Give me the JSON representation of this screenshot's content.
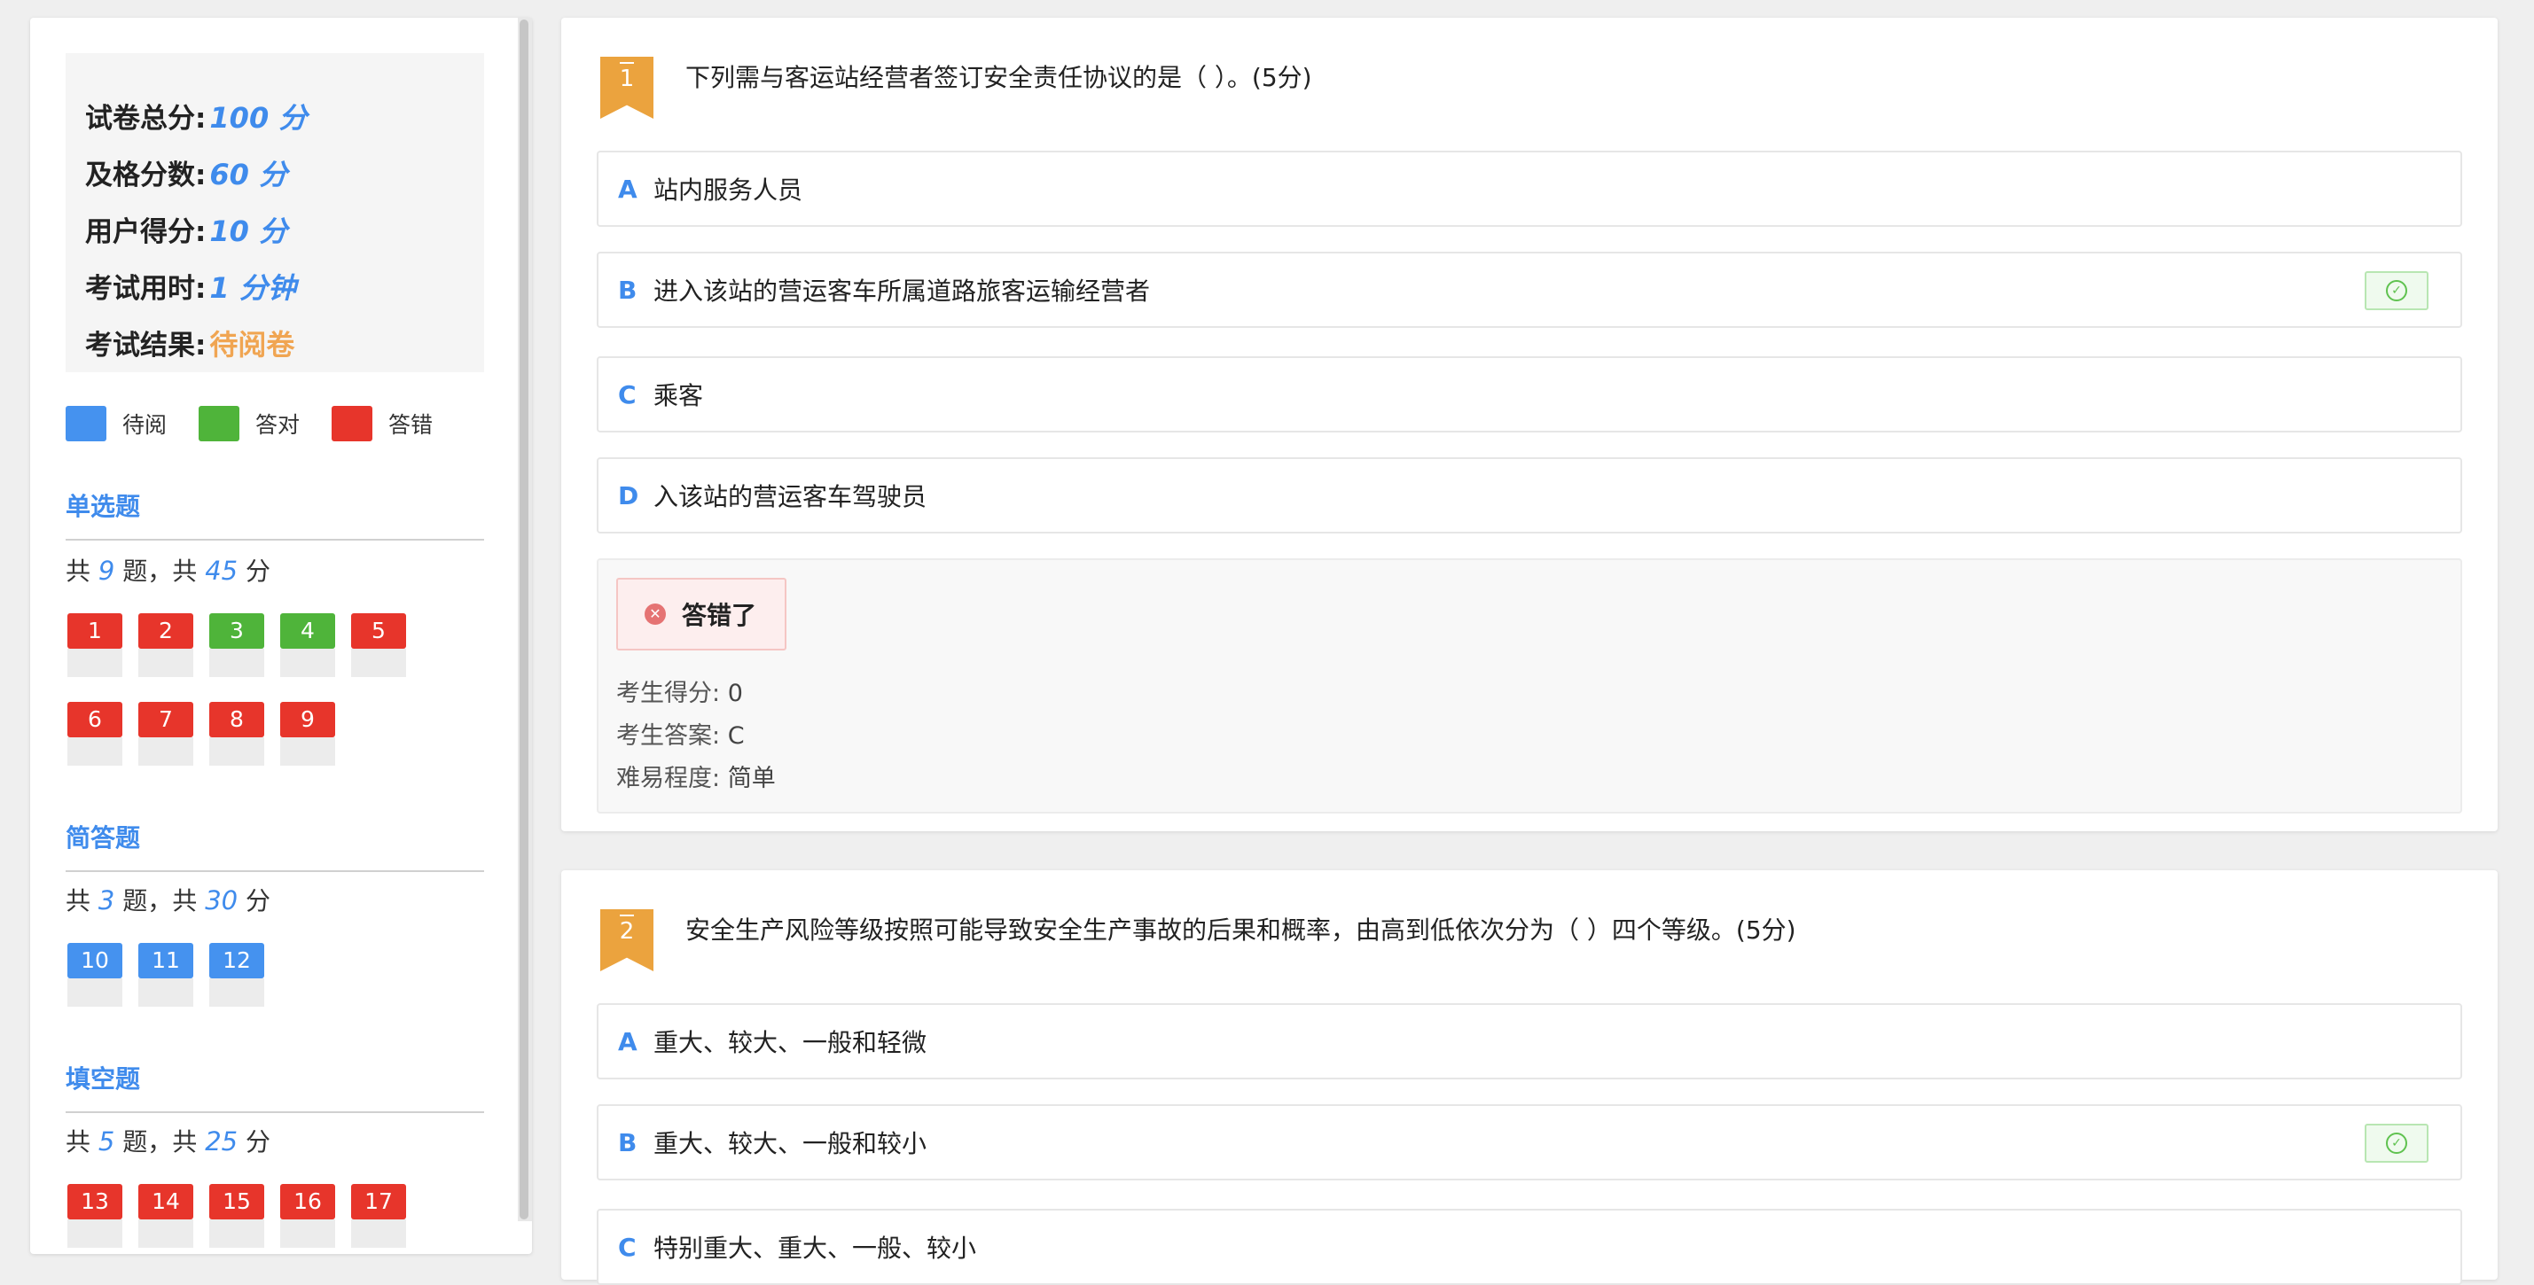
{
  "summary": {
    "total_label": "试卷总分:",
    "total_value": "100 分",
    "pass_label": "及格分数:",
    "pass_value": "60 分",
    "user_label": "用户得分:",
    "user_value": "10 分",
    "time_label": "考试用时:",
    "time_value": "1 分钟",
    "result_label": "考试结果:",
    "result_value": "待阅卷"
  },
  "legend": [
    {
      "label": "待阅",
      "color": "#4592ef"
    },
    {
      "label": "答对",
      "color": "#4fb43a"
    },
    {
      "label": "答错",
      "color": "#e7352b"
    }
  ],
  "sections": [
    {
      "title": "单选题",
      "stat_prefix": "共",
      "count": "9",
      "stat_mid": "题，共",
      "score": "45",
      "stat_suffix": "分",
      "questions": [
        {
          "n": "1",
          "status": "red"
        },
        {
          "n": "2",
          "status": "red"
        },
        {
          "n": "3",
          "status": "green"
        },
        {
          "n": "4",
          "status": "green"
        },
        {
          "n": "5",
          "status": "red"
        },
        {
          "n": "6",
          "status": "red"
        },
        {
          "n": "7",
          "status": "red"
        },
        {
          "n": "8",
          "status": "red"
        },
        {
          "n": "9",
          "status": "red"
        }
      ]
    },
    {
      "title": "简答题",
      "stat_prefix": "共",
      "count": "3",
      "stat_mid": "题，共",
      "score": "30",
      "stat_suffix": "分",
      "questions": [
        {
          "n": "10",
          "status": "blue"
        },
        {
          "n": "11",
          "status": "blue"
        },
        {
          "n": "12",
          "status": "blue"
        }
      ]
    },
    {
      "title": "填空题",
      "stat_prefix": "共",
      "count": "5",
      "stat_mid": "题，共",
      "score": "25",
      "stat_suffix": "分",
      "questions": [
        {
          "n": "13",
          "status": "red"
        },
        {
          "n": "14",
          "status": "red"
        },
        {
          "n": "15",
          "status": "red"
        },
        {
          "n": "16",
          "status": "red"
        },
        {
          "n": "17",
          "status": "red"
        }
      ]
    }
  ],
  "q1": {
    "number": "1",
    "text": "下列需与客运站经营者签订安全责任协议的是（ ）。(5分)",
    "options": [
      {
        "letter": "A",
        "text": "站内服务人员",
        "correct": false
      },
      {
        "letter": "B",
        "text": "进入该站的营运客车所属道路旅客运输经营者",
        "correct": true
      },
      {
        "letter": "C",
        "text": "乘客",
        "correct": false
      },
      {
        "letter": "D",
        "text": "入该站的营运客车驾驶员",
        "correct": false
      }
    ],
    "result_tag": "答错了",
    "score_label": "考生得分:",
    "score_value": "0",
    "answer_label": "考生答案:",
    "answer_value": "C",
    "difficulty_label": "难易程度:",
    "difficulty_value": "简单"
  },
  "q2": {
    "number": "2",
    "text": "安全生产风险等级按照可能导致安全生产事故的后果和概率，由高到低依次分为（ ）四个等级。(5分)",
    "options": [
      {
        "letter": "A",
        "text": "重大、较大、一般和轻微",
        "correct": false
      },
      {
        "letter": "B",
        "text": "重大、较大、一般和较小",
        "correct": true
      },
      {
        "letter": "C",
        "text": "特别重大、重大、一般、较小",
        "correct": false
      }
    ]
  }
}
